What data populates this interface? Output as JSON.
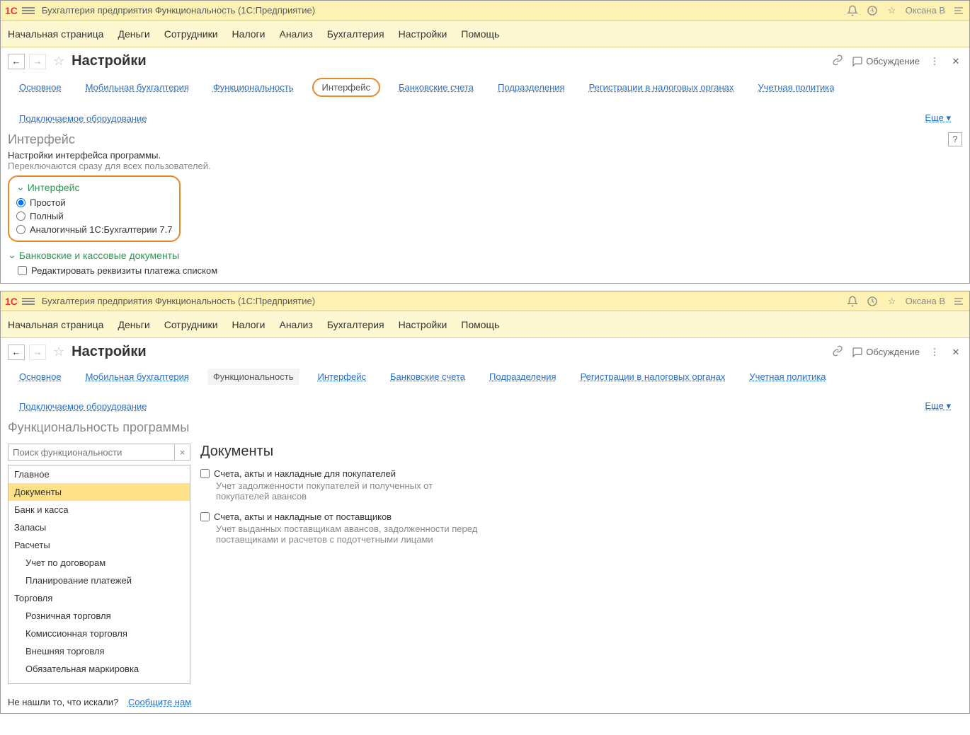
{
  "title_app": "Бухгалтерия предприятия Функциональность  (1С:Предприятие)",
  "user_name": "Оксана В",
  "main_menu": [
    "Начальная страница",
    "Деньги",
    "Сотрудники",
    "Налоги",
    "Анализ",
    "Бухгалтерия",
    "Настройки",
    "Помощь"
  ],
  "page_title": "Настройки",
  "discuss": "Обсуждение",
  "subnav": {
    "items": [
      "Основное",
      "Мобильная бухгалтерия",
      "Функциональность",
      "Интерфейс",
      "Банковские счета",
      "Подразделения",
      "Регистрации в налоговых органах",
      "Учетная политика",
      "Подключаемое оборудование"
    ],
    "more": "Еще"
  },
  "win1": {
    "heading": "Интерфейс",
    "desc1": "Настройки интерфейса программы.",
    "desc2": "Переключаются сразу для всех пользователей.",
    "group1_title": "Интерфейс",
    "radios": [
      "Простой",
      "Полный",
      "Аналогичный 1С:Бухгалтерии 7.7"
    ],
    "group2_title": "Банковские и кассовые документы",
    "check1": "Редактировать реквизиты платежа списком"
  },
  "win2": {
    "heading": "Функциональность программы",
    "search_placeholder": "Поиск функциональности",
    "tree": [
      "Главное",
      "Документы",
      "Банк и касса",
      "Запасы",
      "Расчеты",
      "Учет по договорам",
      "Планирование платежей",
      "Торговля",
      "Розничная торговля",
      "Комиссионная торговля",
      "Внешняя торговля",
      "Обязательная маркировка"
    ],
    "right_title": "Документы",
    "checks": [
      {
        "label": "Счета, акты и накладные для покупателей",
        "sub": "Учет задолженности покупателей и полученных от покупателей авансов"
      },
      {
        "label": "Счета, акты и накладные от поставщиков",
        "sub": "Учет выданных поставщикам авансов, задолженности перед поставщиками и расчетов с подотчетными лицами"
      }
    ],
    "footer_q": "Не нашли то, что искали?",
    "footer_link": "Сообщите нам"
  }
}
